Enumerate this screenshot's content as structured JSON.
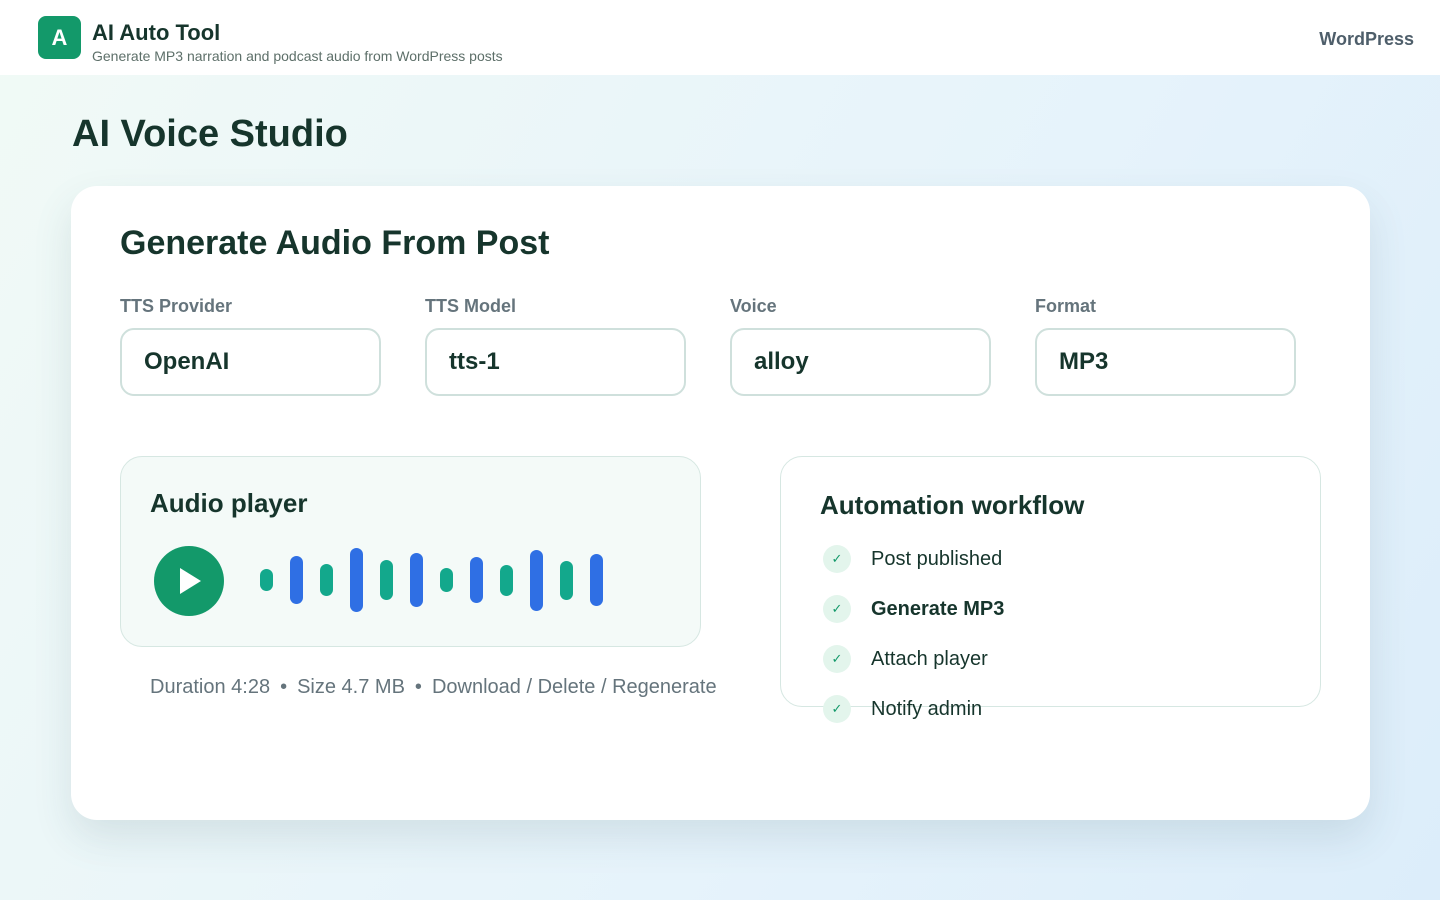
{
  "header": {
    "logo_letter": "A",
    "app_title": "AI Auto Tool",
    "app_subtitle": "Generate MP3 narration and podcast audio from WordPress posts",
    "nav_link": "WordPress"
  },
  "page": {
    "title": "AI Voice Studio"
  },
  "generate": {
    "title": "Generate Audio From Post",
    "fields": [
      {
        "label": "TTS Provider",
        "value": "OpenAI"
      },
      {
        "label": "TTS Model",
        "value": "tts-1"
      },
      {
        "label": "Voice",
        "value": "alloy"
      },
      {
        "label": "Format",
        "value": "MP3"
      }
    ]
  },
  "player": {
    "title": "Audio player",
    "waveform_colors": [
      "#13a88c",
      "#2f6fe4"
    ],
    "waveform_levels": [
      0.33,
      0.73,
      0.49,
      0.97,
      0.61,
      0.82,
      0.37,
      0.69,
      0.47,
      0.92,
      0.59,
      0.79
    ]
  },
  "meta": {
    "duration": "Duration 4:28",
    "separator": "•",
    "size": "Size 4.7 MB",
    "download": "Download",
    "slash": "/",
    "delete": "Delete",
    "regenerate": "Regenerate"
  },
  "workflow": {
    "title": "Automation workflow",
    "steps": [
      {
        "label": "Post published",
        "icon": "check-icon",
        "glyph": "✓",
        "emphasis": false
      },
      {
        "label": "Generate MP3",
        "icon": "check-icon",
        "glyph": "✓",
        "emphasis": true
      },
      {
        "label": "Attach player",
        "icon": "check-icon",
        "glyph": "✓",
        "emphasis": false
      },
      {
        "label": "Notify admin",
        "icon": "check-icon",
        "glyph": "✓",
        "emphasis": false
      }
    ]
  },
  "colors": {
    "brand": "#13996a",
    "text": "#16352c",
    "muted": "#65747c"
  }
}
